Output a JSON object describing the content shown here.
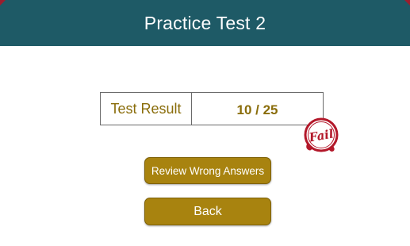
{
  "header": {
    "title": "Practice Test 2",
    "background_color": "#1e5a66",
    "accent_corner_color": "#9b1e2e"
  },
  "result": {
    "label": "Test Result",
    "score": "10 / 25",
    "score_value": 10,
    "score_total": 25,
    "stamp_text": "Fail",
    "stamp_color": "#b3182a",
    "text_color": "#8a6d0b"
  },
  "actions": {
    "review_label": "Review Wrong Answers",
    "back_label": "Back",
    "button_color": "#a8830f"
  }
}
